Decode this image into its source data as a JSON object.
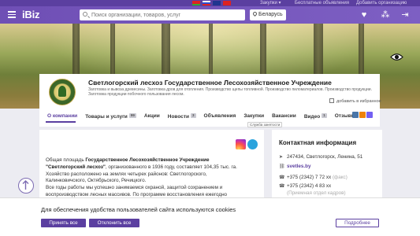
{
  "topbar": {
    "purchases": "Закупки ▾",
    "free_ads": "Бесплатные объявления",
    "add_org": "Добавить организацию"
  },
  "header": {
    "logo": "iBiz",
    "search_placeholder": "Поиск организации, товаров, услуг",
    "region": "Беларусь"
  },
  "company": {
    "name": "Светлогорский лесхоз Государственное Лесохозяйственное Учреждение",
    "description": "Заготовка и вывоза древесины. Заготовка дров для отопления. Производство щепы топливной. Производство пиломатериалов. Производство продукции. Заготовка продукции побочного пользования лесом.",
    "add_favorites": "добавить в избранное",
    "service_button": "Служба занятости"
  },
  "tabs": [
    {
      "label": "О компании",
      "count": ""
    },
    {
      "label": "Товары и услуги",
      "count": "99"
    },
    {
      "label": "Акции",
      "count": ""
    },
    {
      "label": "Новости",
      "count": "3"
    },
    {
      "label": "Объявления",
      "count": ""
    },
    {
      "label": "Закупки",
      "count": ""
    },
    {
      "label": "Вакансии",
      "count": ""
    },
    {
      "label": "Видео",
      "count": "1"
    },
    {
      "label": "Отзывы",
      "count": ""
    }
  ],
  "about": {
    "p1_lead": "Общая площадь ",
    "p1_bold": "Государственное Лесохозяйственное Учреждение \"Светлогорский лесхоз\"",
    "p1_rest": ", организованного в 1936 году, составляет 104,35 тыс. га. Хозяйство расположено на землях четырех районов: Светлогорского, Калинковичского, Октябрьского, Речицкого.",
    "p2": "Все годы работы мы успешно занимаемся охраной, защитой сохранением и воспроизводством лесных массивов. По программе восстановления ежегодно высаживаем около 300 га новых"
  },
  "contacts": {
    "title": "Контактная информация",
    "address": "247434, Светлогорск, Ленина, 51",
    "website": "svetles.by",
    "phone1": "+375 (2342) 7 72 xx",
    "phone1_type": "(факс)",
    "phone2": "+375 (2342) 4 83 xx",
    "phone_note": "(Приемная отдел кадров)"
  },
  "cookie": {
    "message": "Для обеспечения удобства пользователей сайта используются cookies",
    "accept": "Принять все",
    "reject": "Отклонить все",
    "more": "Подробнее"
  },
  "colors": {
    "brand": "#5b3fa0",
    "header": "#7558bb"
  }
}
